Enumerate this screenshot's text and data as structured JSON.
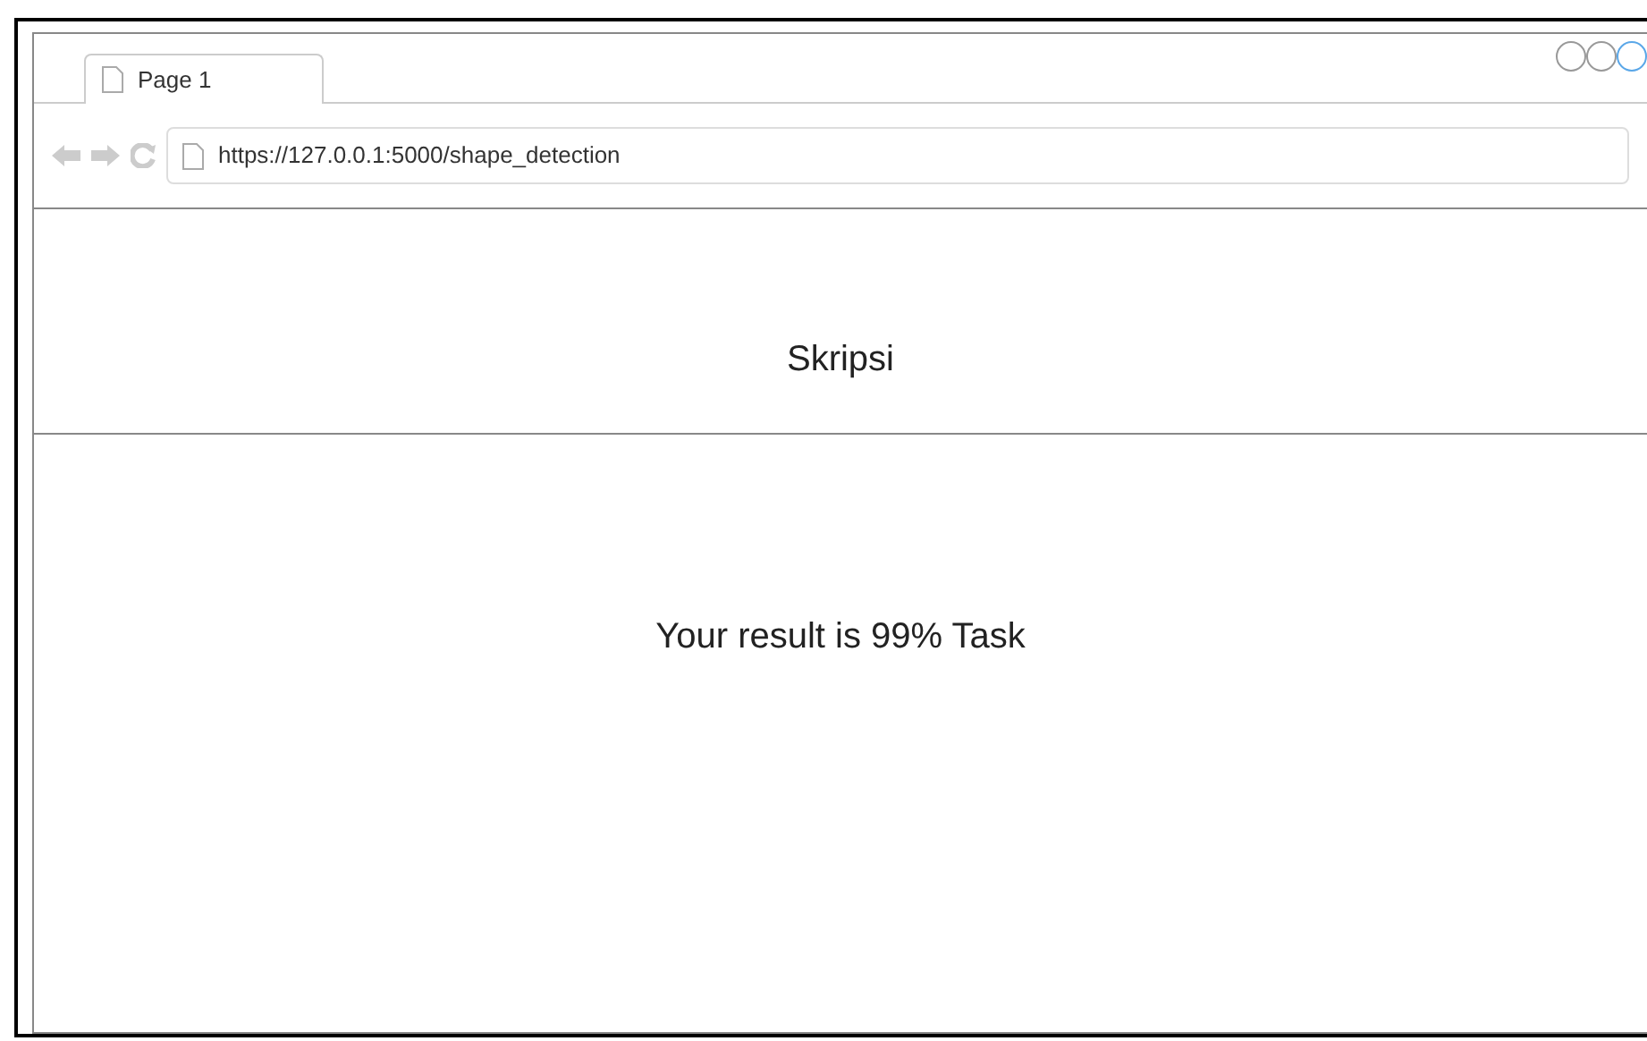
{
  "browser": {
    "tab": {
      "title": "Page 1"
    },
    "address": "https://127.0.0.1:5000/shape_detection"
  },
  "header": {
    "title": "Skripsi"
  },
  "content": {
    "message": "Your result is 99% Task"
  }
}
